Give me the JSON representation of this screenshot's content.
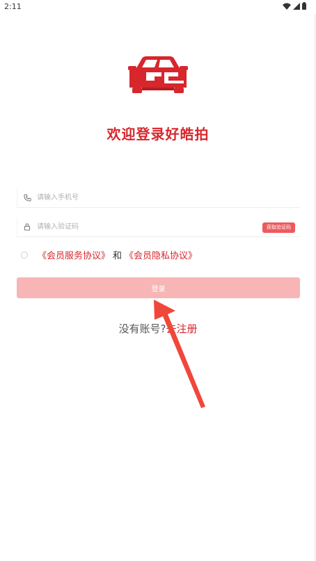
{
  "status_bar": {
    "time": "2:11",
    "icons": [
      "wifi-icon",
      "signal-icon",
      "battery-icon"
    ]
  },
  "logo": {
    "icon": "car-logo-icon",
    "color": "#d7262c"
  },
  "welcome": {
    "title": "欢迎登录好皓拍"
  },
  "form": {
    "phone": {
      "placeholder": "请输入手机号",
      "value": "",
      "icon": "phone-icon"
    },
    "code": {
      "placeholder": "请输入验证码",
      "value": "",
      "icon": "lock-icon"
    },
    "get_code_label": "获取验证码"
  },
  "agreement": {
    "service_label": "《会员服务协议》",
    "and_label": "和",
    "privacy_label": "《会员隐私协议》"
  },
  "login_label": "登录",
  "register": {
    "prompt": "没有账号?",
    "link_label": "去注册"
  },
  "colors": {
    "brand": "#d7262c",
    "login_button": "#f8b5b6",
    "code_button": "#ed5a5f",
    "annotation_arrow": "#f0473b"
  },
  "annotation": {
    "icon": "arrow-annotation-icon"
  }
}
